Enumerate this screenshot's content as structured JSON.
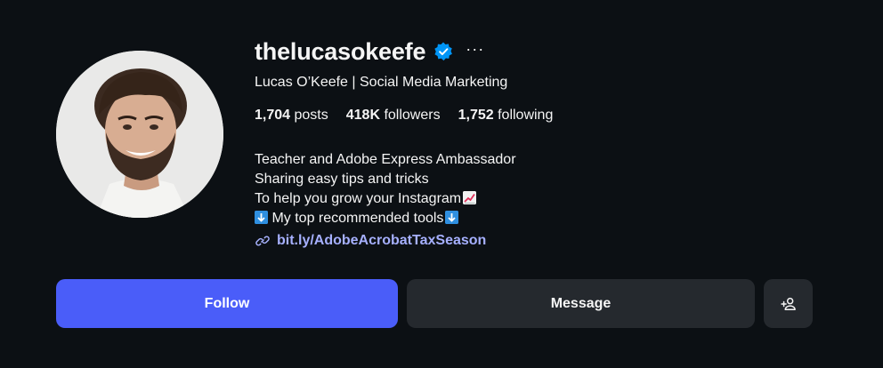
{
  "profile": {
    "username": "thelucasokeefe",
    "full_name": "Lucas O’Keefe | Social Media Marketing",
    "more_label": "···",
    "verified": true
  },
  "stats": {
    "posts_count": "1,704",
    "posts_label": "posts",
    "followers_count": "418K",
    "followers_label": "followers",
    "following_count": "1,752",
    "following_label": "following"
  },
  "bio": {
    "line1": "Teacher and Adobe Express Ambassador",
    "line2": "Sharing easy tips and tricks",
    "line3": "To help you grow your Instagram",
    "line4": "My top recommended tools",
    "emoji_chart": "📈",
    "emoji_down": "⬇"
  },
  "link": {
    "text": "bit.ly/AdobeAcrobatTaxSeason",
    "icon": "link-icon"
  },
  "actions": {
    "follow_label": "Follow",
    "message_label": "Message",
    "suggest_icon": "add-person-icon"
  },
  "colors": {
    "background": "#0c1014",
    "follow_button": "#4a5df9",
    "secondary_button": "#25292e",
    "link": "#a8b3ff",
    "verified_badge": "#0095f6"
  }
}
